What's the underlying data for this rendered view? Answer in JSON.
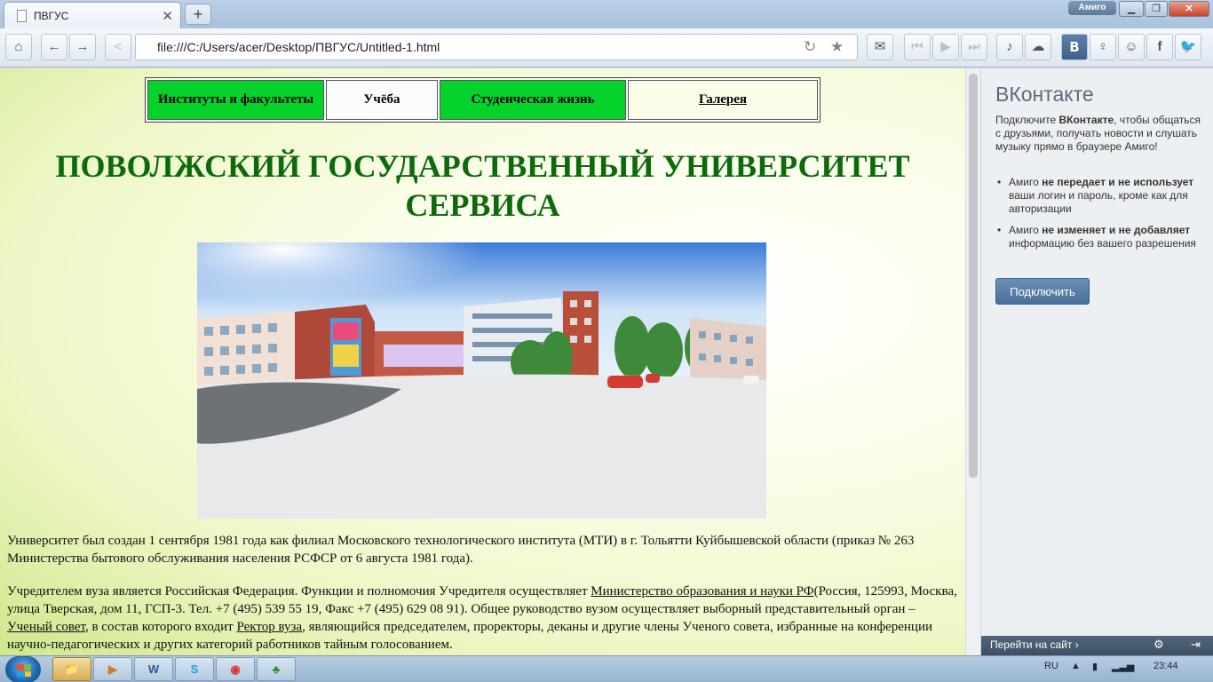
{
  "browser": {
    "tab_title": "ПВГУС",
    "tab_close": "✕",
    "new_tab": "+",
    "profile": "Амиго",
    "address": "file:///C:/Users/acer/Desktop/ПВГУС/Untitled-1.html",
    "vk_button": "B"
  },
  "nav": {
    "items": [
      {
        "label": "Институты и факультеты"
      },
      {
        "label": "Учёба"
      },
      {
        "label": "Студенческая жизнь"
      },
      {
        "label": "Галерея"
      }
    ]
  },
  "page": {
    "heading_line1": "ПОВОЛЖСКИЙ ГОСУДАРСТВЕННЫЙ УНИВЕРСИТЕТ",
    "heading_line2": "СЕРВИСА",
    "para1": "Университет был создан 1 сентября 1981 года как филиал Московского технологического института (МТИ) в г. Тольятти Куйбышевской области (приказ № 263 Министерства бытового обслуживания населения РСФСР от 6 августа 1981 года).",
    "para2": {
      "t1": "Учредителем вуза является Российская Федерация. Функции и полномочия Учредителя осуществляет ",
      "link1": "Министерство образования и науки РФ",
      "t2": "(Россия, 125993, Москва, улица Тверская, дом 11, ГСП-3. Тел. +7 (495) 539 55 19, Факс +7 (495) 629 08 91). Общее руководство вузом осуществляет выборный представительный орган – ",
      "link2": "Ученый совет",
      "t3": ", в состав которого входит ",
      "link3": "Ректор вуза",
      "t4": ", являющийся председателем, проректоры, деканы и другие члены Ученого совета, избранные на конференции научно-педагогических и других категорий работников тайным голосованием."
    }
  },
  "sidebar": {
    "title": "ВКонтакте",
    "intro_a": "Подключите ",
    "intro_b": "ВКонтакте",
    "intro_c": ", чтобы общаться с друзьями, получать новости и слушать музыку прямо в браузере Амиго!",
    "bullet1_a": "Амиго ",
    "bullet1_b": "не передает и не использует",
    "bullet1_c": " ваши логин и пароль, кроме как для авторизации",
    "bullet2_a": "Амиго ",
    "bullet2_b": "не изменяет и не добавляет",
    "bullet2_c": " информацию без вашего разрешения",
    "connect": "Подключить",
    "footer_go": "Перейти на сайт ›"
  },
  "taskbar": {
    "lang": "RU",
    "time": "23:44",
    "word_label": "W"
  }
}
